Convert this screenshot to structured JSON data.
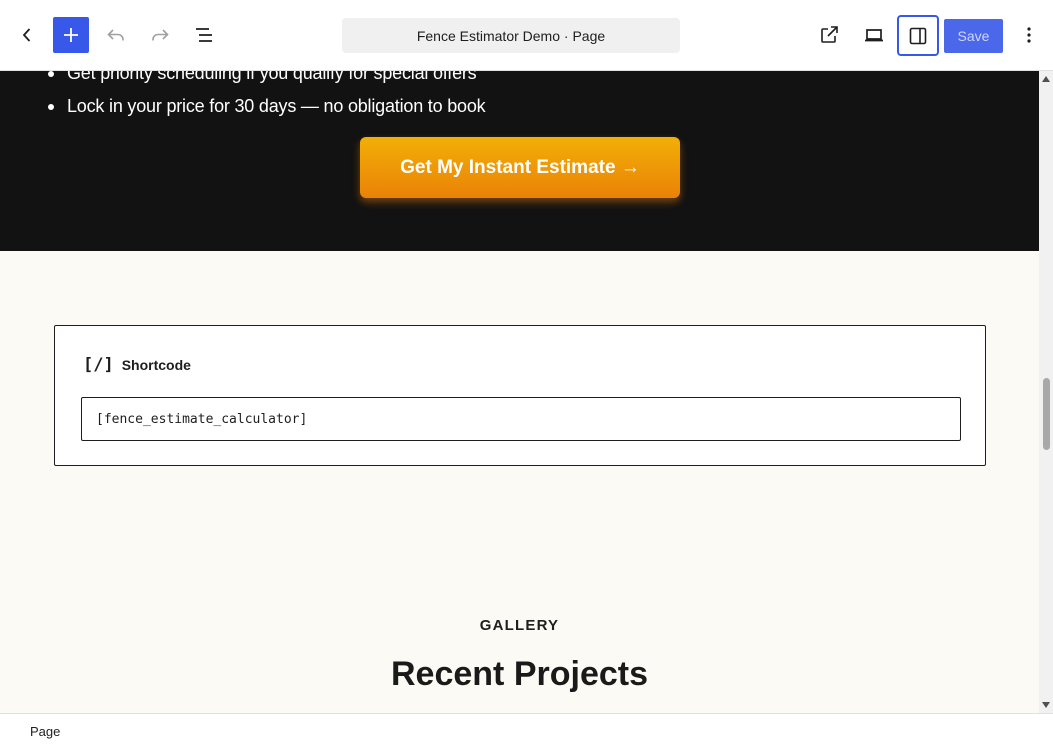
{
  "toolbar": {
    "document_title": "Fence Estimator Demo · Page",
    "save_label": "Save",
    "icons": {
      "back": "chevron-left-icon",
      "add": "plus-icon",
      "undo": "undo-icon",
      "redo": "redo-icon",
      "list_view": "list-view-icon",
      "view": "external-link-icon",
      "device": "laptop-icon",
      "settings": "sidebar-panel-icon",
      "options": "more-vertical-icon"
    },
    "colors": {
      "accent": "#3858e9"
    }
  },
  "content": {
    "benefits": [
      "Get priority scheduling if you qualify for special offers",
      "Lock in your price for 30 days — no obligation to book"
    ],
    "cta_label": "Get My Instant Estimate →",
    "shortcode_block": {
      "icon": "[/]",
      "label": "Shortcode",
      "value": "[fence_estimate_calculator]"
    },
    "gallery_eyebrow": "GALLERY",
    "gallery_title": "Recent Projects",
    "colors": {
      "cta_top": "#f2af07",
      "cta_bottom": "#ea8207",
      "dark_band": "#121212",
      "page_bg": "#fbfaf4"
    }
  },
  "footer": {
    "breadcrumb": "Page"
  }
}
